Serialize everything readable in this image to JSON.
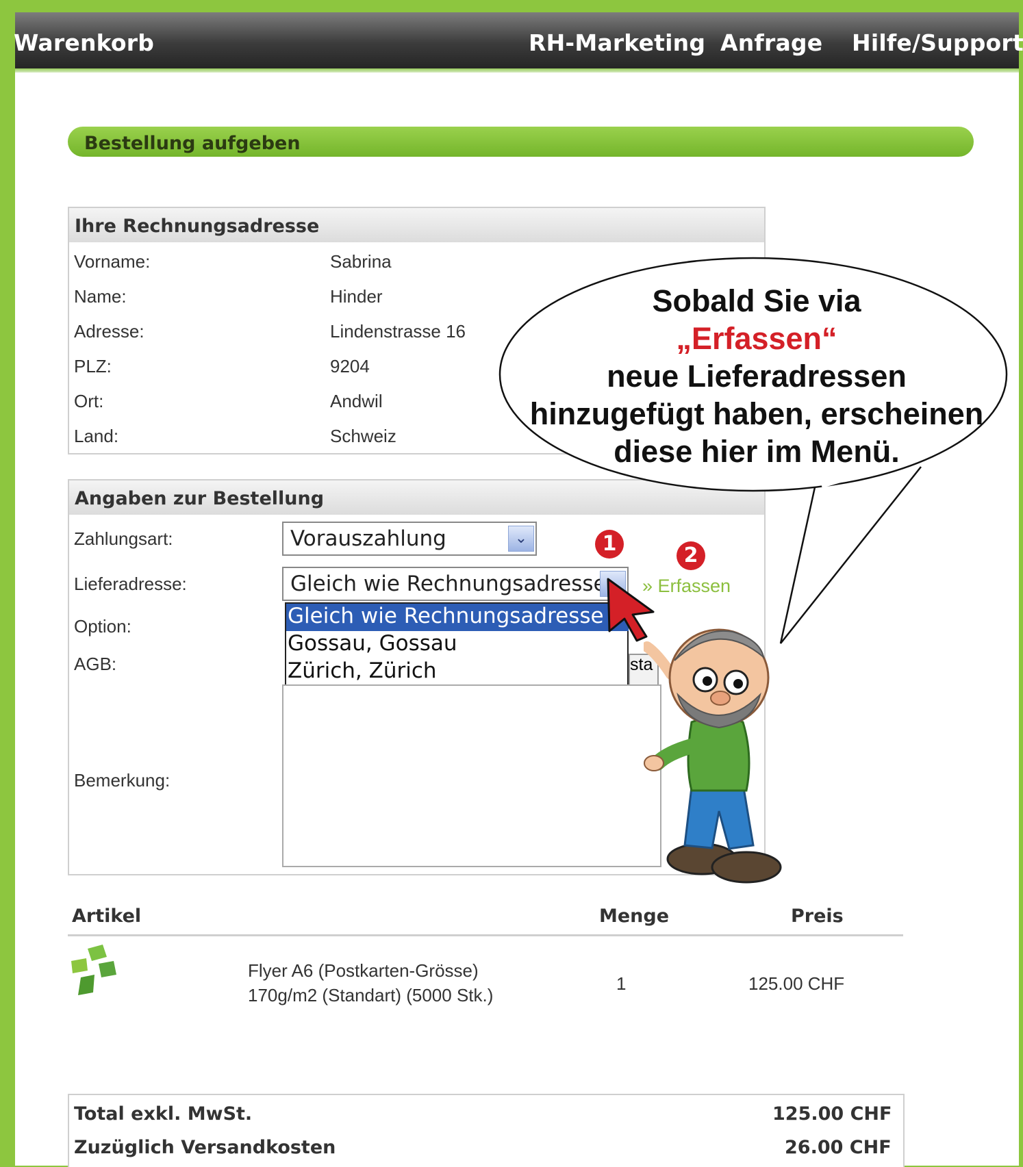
{
  "nav": {
    "cart": "Warenkorb",
    "marketing": "RH-Marketing",
    "inquiry": "Anfrage",
    "help": "Hilfe/Support"
  },
  "section_title": "Bestellung aufgeben",
  "billing": {
    "title": "Ihre Rechnungsadresse",
    "rows": [
      {
        "label": "Vorname:",
        "value": "Sabrina"
      },
      {
        "label": "Name:",
        "value": "Hinder"
      },
      {
        "label": "Adresse:",
        "value": "Lindenstrasse 16"
      },
      {
        "label": "PLZ:",
        "value": "9204"
      },
      {
        "label": "Ort:",
        "value": "Andwil"
      },
      {
        "label": "Land:",
        "value": "Schweiz"
      }
    ]
  },
  "order": {
    "title": "Angaben zur Bestellung",
    "payment_label": "Zahlungsart:",
    "payment_value": "Vorauszahlung",
    "delivery_label": "Lieferadresse:",
    "delivery_value": "Gleich wie Rechnungsadresse",
    "delivery_options": [
      "Gleich wie Rechnungsadresse",
      "Gossau, Gossau",
      "Zürich, Zürich"
    ],
    "erfassen_link": "» Erfassen",
    "option_label": "Option:",
    "agb_label": "AGB:",
    "agb_partial": "sta",
    "remark_label": "Bemerkung:"
  },
  "callout": {
    "line1": "Sobald Sie via",
    "highlight": "„Erfassen“",
    "line3": "neue Lieferadressen",
    "line4": "hinzugefügt haben, erscheinen",
    "line5": "diese hier im Menü."
  },
  "badges": {
    "one": "1",
    "two": "2"
  },
  "items": {
    "headers": {
      "article": "Artikel",
      "qty": "Menge",
      "price": "Preis"
    },
    "rows": [
      {
        "name_line1": "Flyer A6 (Postkarten-Grösse)",
        "name_line2": "170g/m2 (Standart) (5000 Stk.)",
        "qty": "1",
        "price": "125.00 CHF"
      }
    ]
  },
  "totals": [
    {
      "label": "Total exkl. MwSt.",
      "value": "125.00 CHF"
    },
    {
      "label": "Zuzüglich Versandkosten",
      "value": "26.00 CHF"
    }
  ],
  "colors": {
    "accent_green": "#8dc63f",
    "selection_blue": "#2d5db5",
    "badge_red": "#d42027"
  }
}
